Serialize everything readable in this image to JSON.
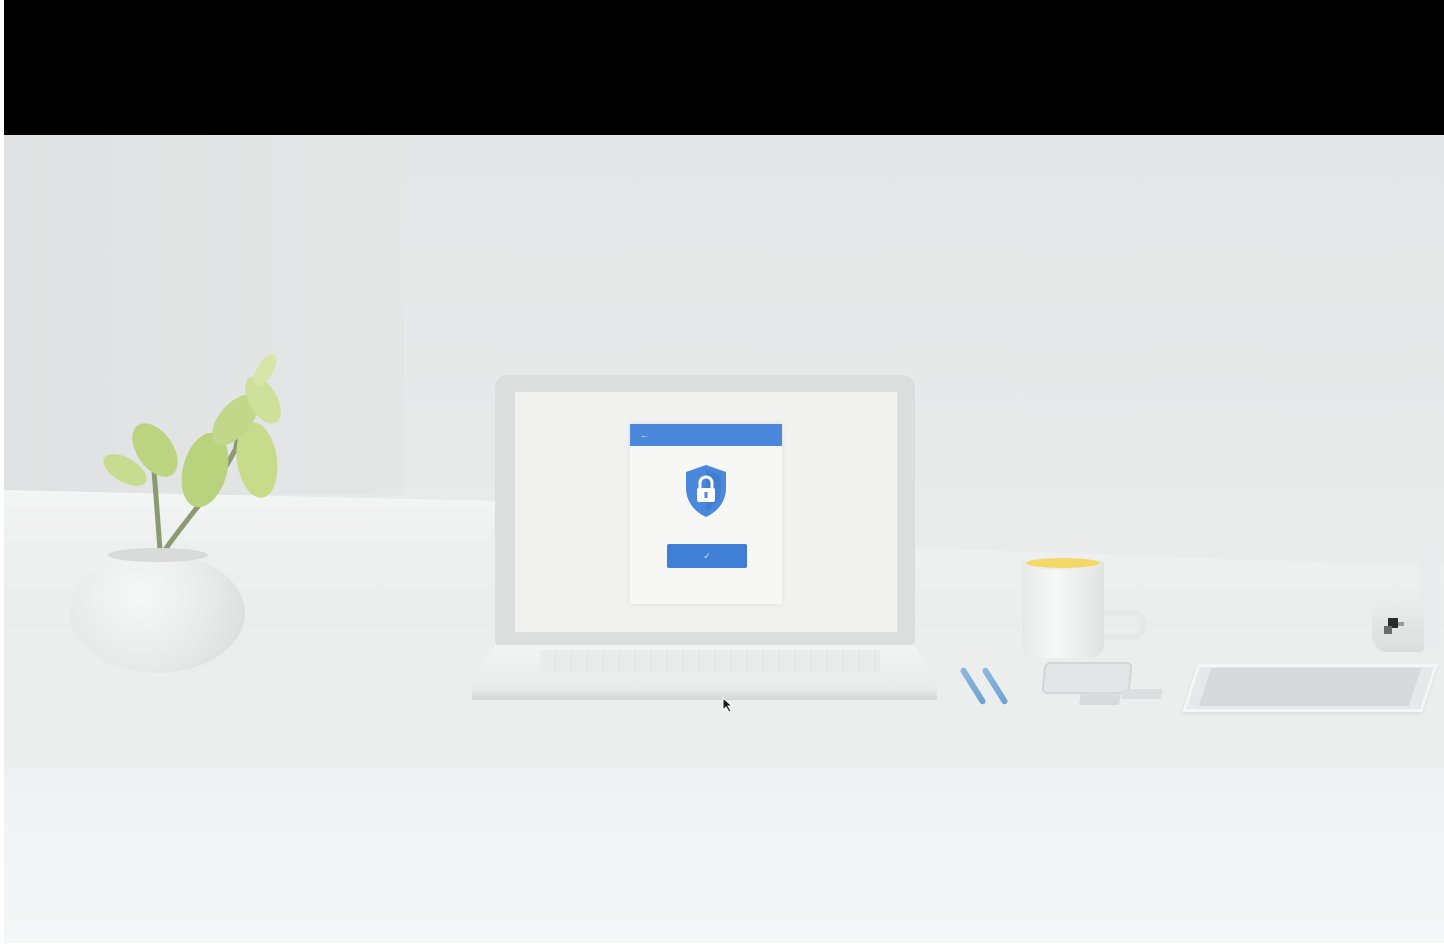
{
  "scene": {
    "background_color": "#e8eaea",
    "letterbox_color": "#000000"
  },
  "laptop_dialog": {
    "accent_color": "#4a88dc",
    "header_icon": "back-arrow-icon",
    "title": "",
    "center_icon": "lock-shield-icon",
    "button_icon": "check-icon",
    "button_label": ""
  },
  "objects": {
    "plant": "potted-plant",
    "mug_rim_color": "#f4d969",
    "pens_color": "#6ea2d3"
  }
}
